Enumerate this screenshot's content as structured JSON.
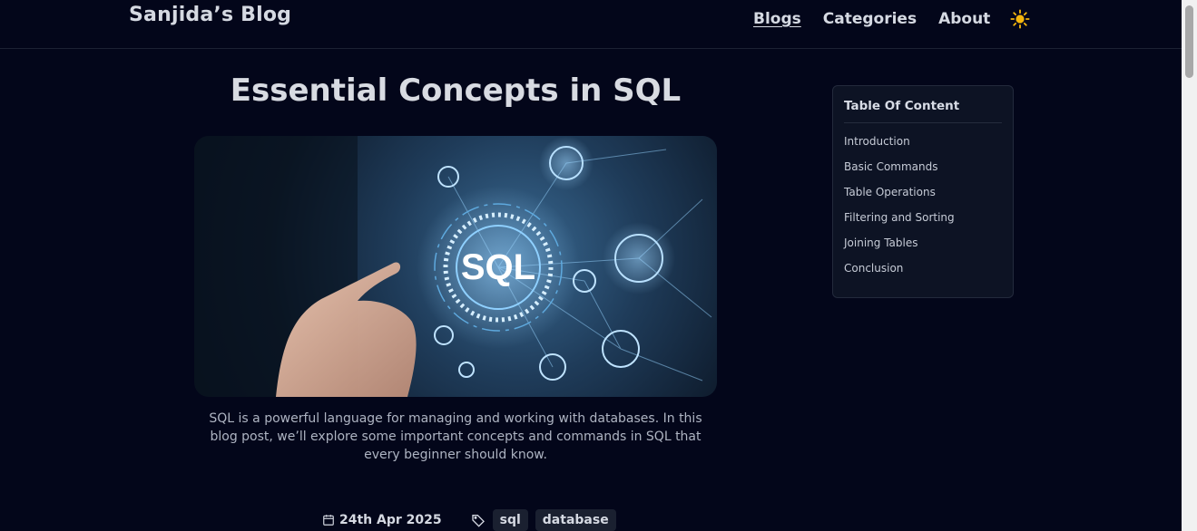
{
  "header": {
    "brand": "Sanjida’s Blog",
    "nav": [
      "Blogs",
      "Categories",
      "About"
    ],
    "theme_icon": "sun-icon"
  },
  "post": {
    "title": "Essential Concepts in SQL",
    "hero_text": "SQL",
    "description": "SQL is a powerful language for managing and working with databases. In this blog post, we’ll explore some important concepts and commands in SQL that every beginner should know.",
    "date": "24th Apr 2025",
    "tags": [
      "sql",
      "database"
    ]
  },
  "toc": {
    "heading": "Table Of Content",
    "items": [
      "Introduction",
      "Basic Commands",
      "Table Operations",
      "Filtering and Sorting",
      "Joining Tables",
      "Conclusion"
    ]
  },
  "colors": {
    "background": "#03061a",
    "panel": "#0d1324",
    "accent_sun": "#f5b60d"
  }
}
